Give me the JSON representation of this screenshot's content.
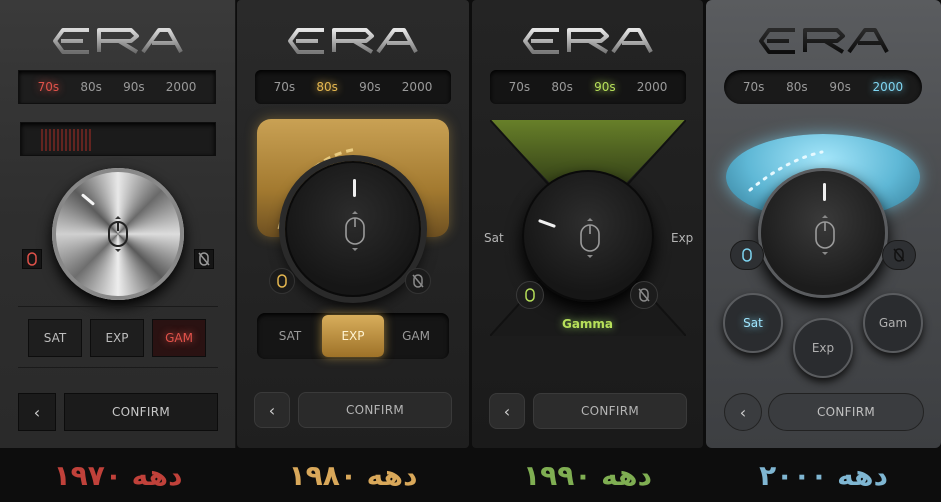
{
  "logo_text": "ERA",
  "decade_tabs": [
    "70s",
    "80s",
    "90s",
    "2000"
  ],
  "panels": {
    "p70": {
      "active_tab": "70s",
      "modes": [
        "SAT",
        "EXP",
        "GAM"
      ],
      "active_mode": "GAM",
      "confirm_label": "CONFIRM",
      "back_label": "‹"
    },
    "p80": {
      "active_tab": "80s",
      "modes": [
        "SAT",
        "EXP",
        "GAM"
      ],
      "active_mode": "EXP",
      "confirm_label": "CONFIRM",
      "back_label": "‹"
    },
    "p90": {
      "active_tab": "90s",
      "left_label": "Sat",
      "right_label": "Exp",
      "mode_label": "Gamma",
      "confirm_label": "CONFIRM",
      "back_label": "‹"
    },
    "p00": {
      "active_tab": "2000",
      "modes": [
        "Sat",
        "Exp",
        "Gam"
      ],
      "active_mode": "Sat",
      "confirm_label": "CONFIRM",
      "back_label": "‹"
    }
  },
  "captions": [
    "دهه ۱۹۷۰",
    "دهه ۱۹۸۰",
    "دهه ۱۹۹۰",
    "دهه ۲۰۰۰"
  ],
  "colors": {
    "caption_70": "#c0413a",
    "caption_80": "#d9a85a",
    "caption_90": "#7fae52",
    "caption_00": "#7fb6d2",
    "accent_70": "#e0524a",
    "accent_80": "#e6b850",
    "accent_90": "#b7e05a",
    "accent_00": "#7fd6f2"
  },
  "icons": [
    "mouse-icon",
    "mouse-icon-crossed",
    "chevron-left-icon"
  ]
}
